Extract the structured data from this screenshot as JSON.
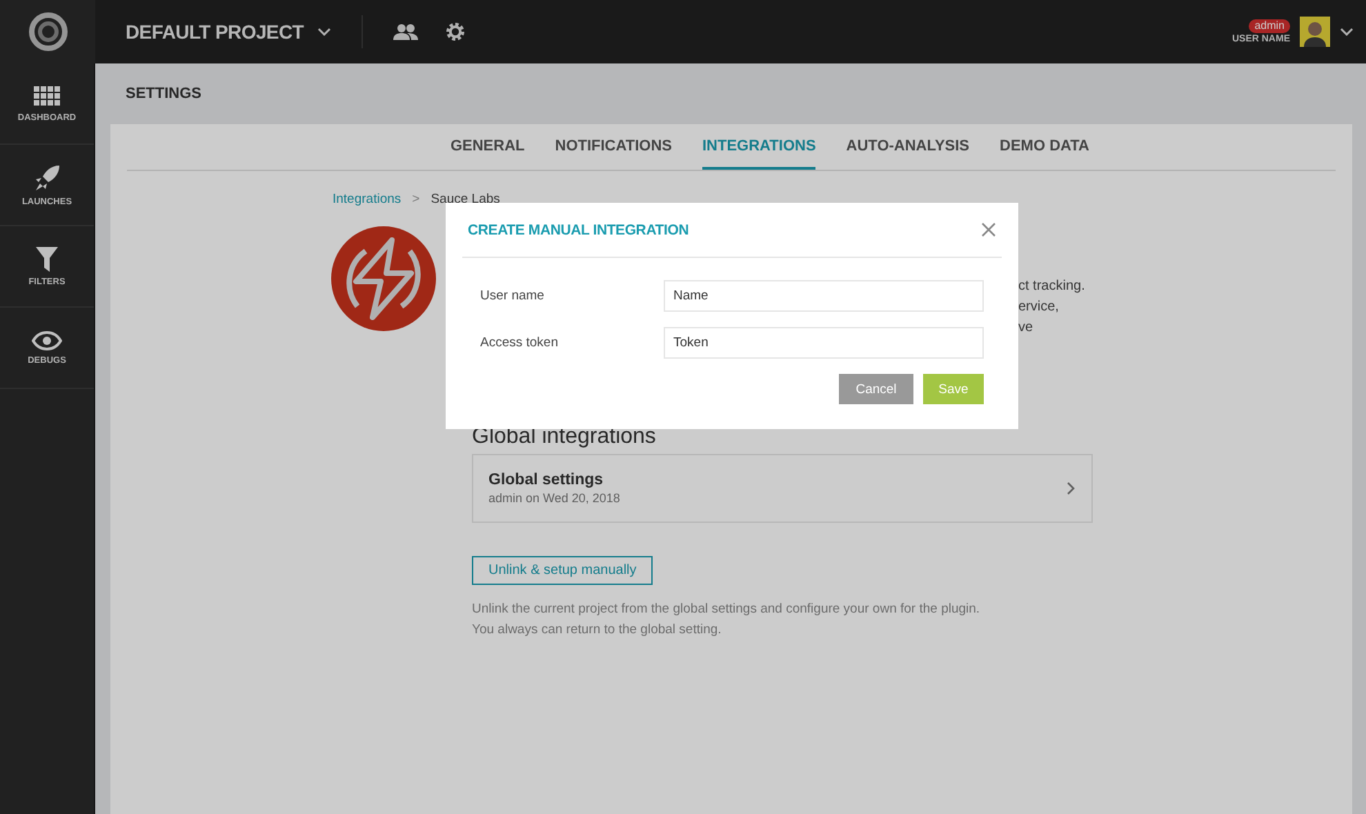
{
  "topbar": {
    "project": "DEFAULT PROJECT",
    "user": {
      "role": "admin",
      "name": "USER NAME"
    }
  },
  "sidebar": {
    "items": [
      {
        "label": "DASHBOARD",
        "selected": false
      },
      {
        "label": "LAUNCHES",
        "selected": false
      },
      {
        "label": "FILTERS",
        "selected": false
      },
      {
        "label": "DEBUGS",
        "selected": false
      }
    ]
  },
  "page_title": "SETTINGS",
  "tabs": [
    {
      "label": "GENERAL",
      "selected": false
    },
    {
      "label": "NOTIFICATIONS",
      "selected": false
    },
    {
      "label": "INTEGRATIONS",
      "selected": true
    },
    {
      "label": "AUTO-ANALYSIS",
      "selected": false
    },
    {
      "label": "DEMO DATA",
      "selected": false
    }
  ],
  "breadcrumb_separator": ">",
  "breadcrumb": [
    {
      "label": "Integrations",
      "kind": "link"
    },
    {
      "label": "Sauce Labs",
      "kind": "current"
    }
  ],
  "description_fragments": [
    "ct tracking.",
    "ervice,",
    "ve"
  ],
  "global_heading": "Global integrations",
  "global_card": {
    "title": "Global settings",
    "subtitle": "admin on Wed 20, 2018"
  },
  "unlink_button": "Unlink & setup manually",
  "unlink_note": [
    "Unlink the current project from the global settings and configure your own for the plugin.",
    "You always can return to the global setting."
  ],
  "modal": {
    "title": "CREATE MANUAL INTEGRATION",
    "fields": [
      {
        "label": "User name",
        "value": "Name"
      },
      {
        "label": "Access token",
        "value": "Token"
      }
    ],
    "buttons": [
      {
        "label": "Cancel",
        "kind": "secondary"
      },
      {
        "label": "Save",
        "kind": "primary"
      }
    ]
  }
}
